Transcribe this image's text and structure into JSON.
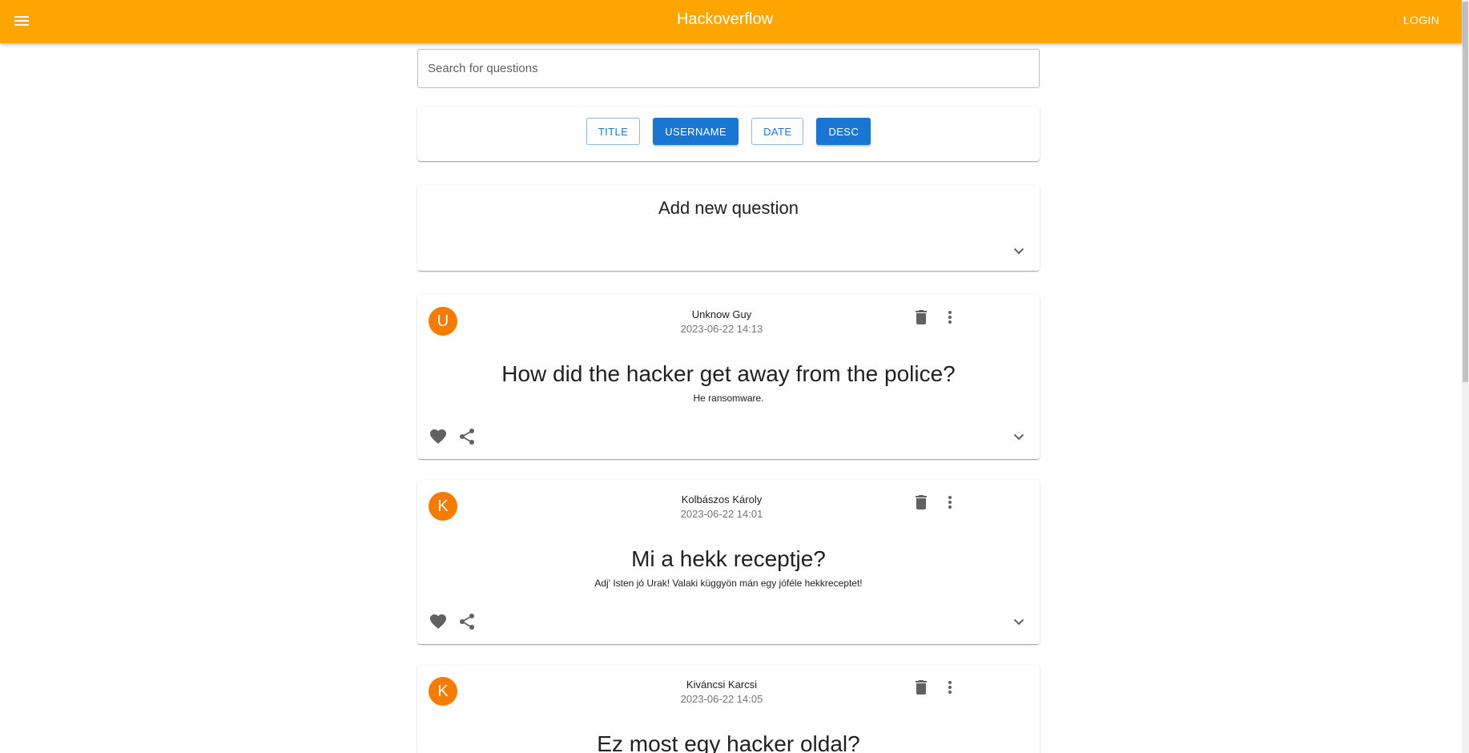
{
  "appbar": {
    "title": "Hackoverflow",
    "login_label": "LOGIN",
    "color": "#ffa500"
  },
  "search": {
    "placeholder": "Search for questions",
    "value": ""
  },
  "sort": {
    "buttons": [
      {
        "label": "TITLE",
        "active": false
      },
      {
        "label": "USERNAME",
        "active": true
      },
      {
        "label": "DATE",
        "active": false
      },
      {
        "label": "DESC",
        "active": true
      }
    ],
    "accent_color": "#1976d2"
  },
  "add_question": {
    "title": "Add new question"
  },
  "questions": [
    {
      "avatar_letter": "U",
      "username": "Unknow Guy",
      "date": "2023-06-22 14:13",
      "title": "How did the hacker get away from the police?",
      "body": "He ransomware."
    },
    {
      "avatar_letter": "K",
      "username": "Kolbászos Károly",
      "date": "2023-06-22 14:01",
      "title": "Mi a hekk receptje?",
      "body": "Adj' Isten jó Urak! Valaki küggyön mán egy jóféle hekkreceptet!"
    },
    {
      "avatar_letter": "K",
      "username": "Kiváncsi Karcsi",
      "date": "2023-06-22 14:05",
      "title": "Ez most egy hacker oldal?",
      "body": ""
    }
  ],
  "icons": {
    "menu": "menu-icon",
    "delete": "trash-icon",
    "more": "more-vert-icon",
    "like": "heart-icon",
    "share": "share-icon",
    "expand": "chevron-down-icon"
  },
  "avatar_color": "#f57c00"
}
